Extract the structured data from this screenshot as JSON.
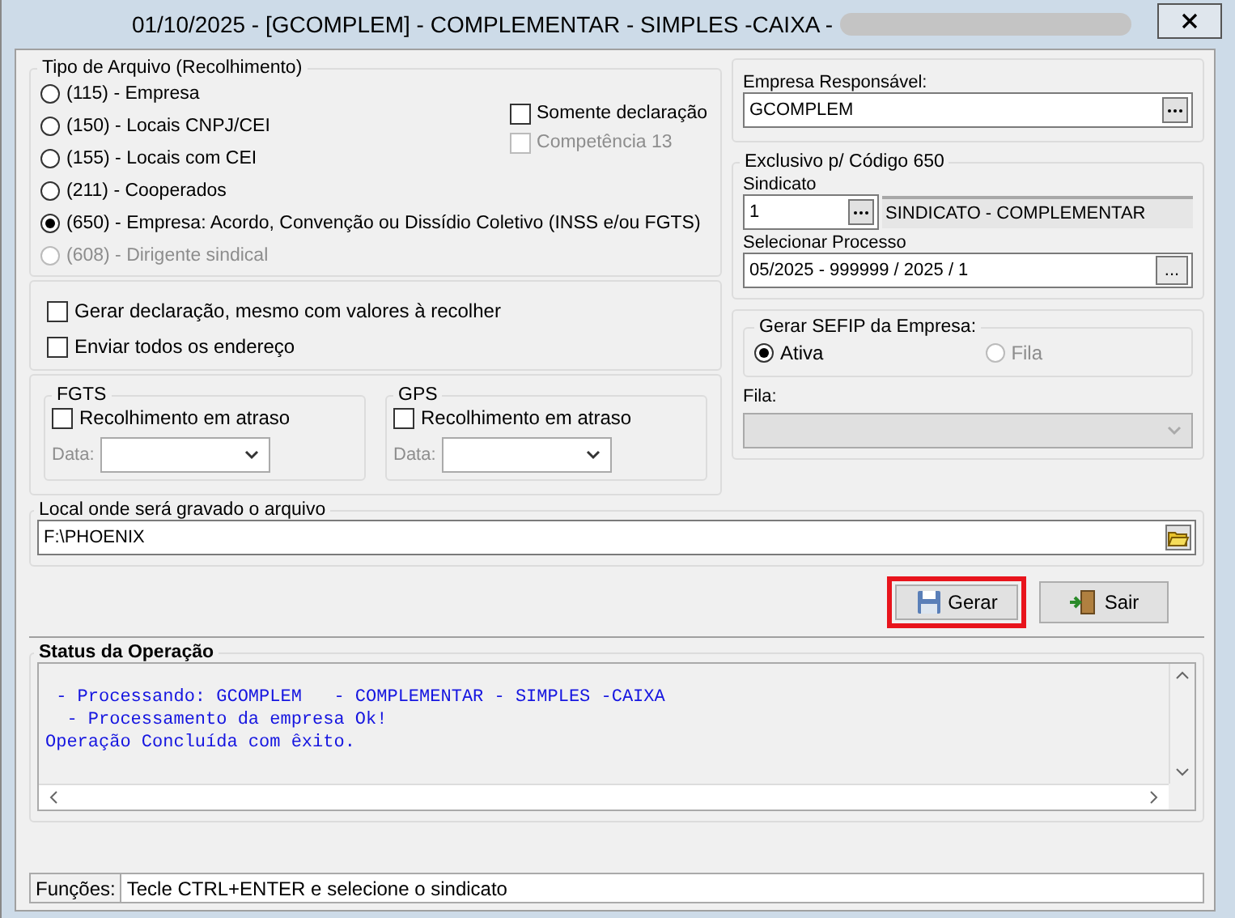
{
  "window": {
    "title": "01/10/2025 - [GCOMPLEM] - COMPLEMENTAR - SIMPLES -CAIXA -",
    "title_redacted": true
  },
  "tipo_arquivo": {
    "title": "Tipo de Arquivo (Recolhimento)",
    "options": [
      {
        "label": "(115) - Empresa",
        "selected": false,
        "disabled": false
      },
      {
        "label": "(150) - Locais CNPJ/CEI",
        "selected": false,
        "disabled": false
      },
      {
        "label": "(155) - Locais com CEI",
        "selected": false,
        "disabled": false
      },
      {
        "label": "(211) - Cooperados",
        "selected": false,
        "disabled": false
      },
      {
        "label": "(650) - Empresa: Acordo, Convenção ou Dissídio Coletivo (INSS e/ou FGTS)",
        "selected": true,
        "disabled": false
      },
      {
        "label": "(608) - Dirigente sindical",
        "selected": false,
        "disabled": true
      }
    ],
    "checks": [
      {
        "label": "Somente declaração",
        "checked": false,
        "disabled": false
      },
      {
        "label": "Competência 13",
        "checked": false,
        "disabled": true
      }
    ]
  },
  "options": [
    {
      "label": "Gerar declaração, mesmo com valores à recolher",
      "checked": false
    },
    {
      "label": "Enviar todos os endereço",
      "checked": false
    }
  ],
  "atraso": [
    {
      "title": "FGTS",
      "label": "Recolhimento em atraso",
      "checked": false,
      "date_label": "Data:"
    },
    {
      "title": "GPS",
      "label": "Recolhimento em atraso",
      "checked": false,
      "date_label": "Data:"
    }
  ],
  "empresa": {
    "label": "Empresa Responsável:",
    "value": "GCOMPLEM"
  },
  "exclusivo": {
    "title": "Exclusivo p/ Código 650",
    "sindicato_label": "Sindicato",
    "sindicato_code": "1",
    "sindicato_name": "SINDICATO - COMPLEMENTAR",
    "processo_label": "Selecionar Processo",
    "processo_value": "05/2025 - 999999 / 2025 / 1",
    "processo_button": "..."
  },
  "sefip": {
    "title": "Gerar SEFIP da Empresa:",
    "options": [
      {
        "label": "Ativa",
        "selected": true,
        "disabled": false
      },
      {
        "label": "Fila",
        "selected": false,
        "disabled": true
      }
    ],
    "fila_label": "Fila:"
  },
  "local": {
    "title": "Local onde será gravado o arquivo",
    "value": "F:\\PHOENIX"
  },
  "buttons": [
    {
      "kind": "save",
      "label": "Gerar",
      "highlighted": true
    },
    {
      "kind": "exit",
      "label": "Sair",
      "highlighted": false
    }
  ],
  "status": {
    "title": "Status da Operação",
    "lines": [
      " - Processando: GCOMPLEM   - COMPLEMENTAR - SIMPLES -CAIXA",
      "  - Processamento da empresa Ok!",
      "Operação Concluída com êxito."
    ]
  },
  "status_bar": {
    "label": "Funções:",
    "text": "Tecle CTRL+ENTER e selecione o sindicato"
  }
}
